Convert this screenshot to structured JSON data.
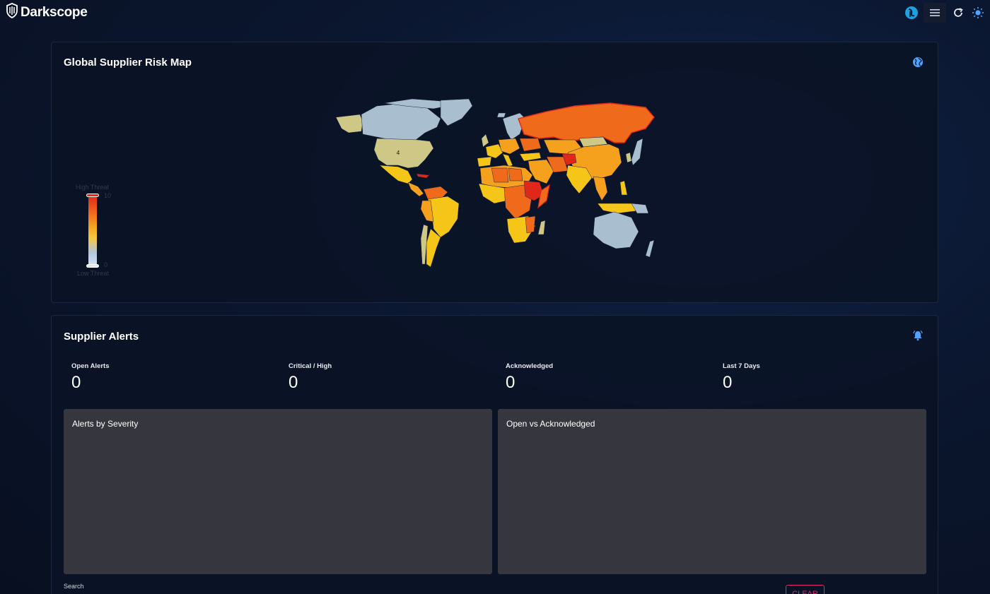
{
  "app": {
    "brand": "Darkscope",
    "actions": [
      "avatar-icon",
      "menu-icon",
      "refresh-icon",
      "theme-toggle-icon"
    ]
  },
  "map_card": {
    "title": "Global Supplier Risk Map",
    "icon": "globe-icon",
    "legend": {
      "high_label": "High Threat",
      "low_label": "Low Threat",
      "max_value": "10",
      "min_value": "0"
    },
    "country_badge": "4",
    "colors": {
      "low": "#a9bfd0",
      "mid_low": "#cfc786",
      "mid": "#f5c518",
      "mid_high": "#f6a11d",
      "high": "#f06a1c",
      "critical": "#e0281a"
    }
  },
  "alerts_card": {
    "title": "Supplier Alerts",
    "icon": "bell-alert-icon",
    "stats": [
      {
        "label": "Open Alerts",
        "value": "0"
      },
      {
        "label": "Critical / High",
        "value": "0"
      },
      {
        "label": "Acknowledged",
        "value": "0"
      },
      {
        "label": "Last 7 Days",
        "value": "0"
      }
    ],
    "panels": [
      {
        "title": "Alerts by Severity"
      },
      {
        "title": "Open vs Acknowledged"
      }
    ],
    "search_label": "Search",
    "clear_label": "CLEAR"
  }
}
